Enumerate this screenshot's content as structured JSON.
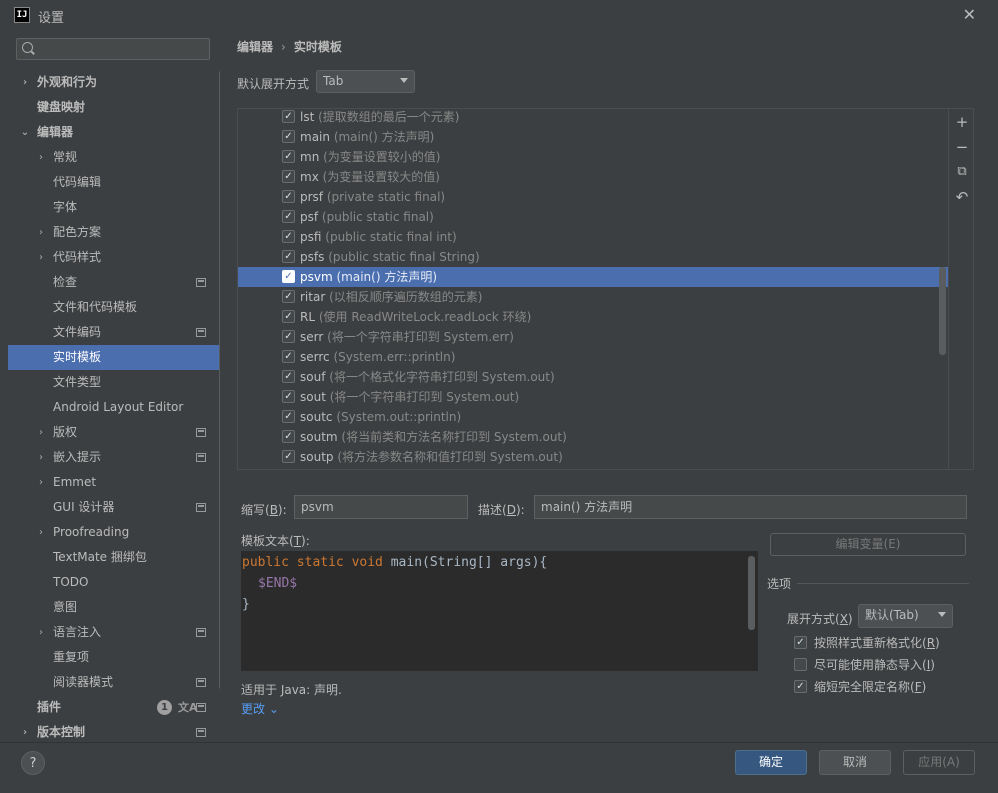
{
  "window": {
    "title": "设置",
    "app_icon": "IJ"
  },
  "sidebar": {
    "search_placeholder": "",
    "items": [
      {
        "label": "外观和行为",
        "level": 0,
        "arrow": "›",
        "bold": true
      },
      {
        "label": "键盘映射",
        "level": 0,
        "arrow": "",
        "bold": true
      },
      {
        "label": "编辑器",
        "level": 0,
        "arrow": "⌄",
        "bold": true
      },
      {
        "label": "常规",
        "level": 1,
        "arrow": "›"
      },
      {
        "label": "代码编辑",
        "level": 1,
        "arrow": ""
      },
      {
        "label": "字体",
        "level": 1,
        "arrow": ""
      },
      {
        "label": "配色方案",
        "level": 1,
        "arrow": "›"
      },
      {
        "label": "代码样式",
        "level": 1,
        "arrow": "›"
      },
      {
        "label": "检查",
        "level": 1,
        "arrow": "",
        "proj": true
      },
      {
        "label": "文件和代码模板",
        "level": 1,
        "arrow": ""
      },
      {
        "label": "文件编码",
        "level": 1,
        "arrow": "",
        "proj": true
      },
      {
        "label": "实时模板",
        "level": 1,
        "arrow": "",
        "selected": true
      },
      {
        "label": "文件类型",
        "level": 1,
        "arrow": ""
      },
      {
        "label": "Android Layout Editor",
        "level": 1,
        "arrow": ""
      },
      {
        "label": "版权",
        "level": 1,
        "arrow": "›",
        "proj": true
      },
      {
        "label": "嵌入提示",
        "level": 1,
        "arrow": "›",
        "proj": true
      },
      {
        "label": "Emmet",
        "level": 1,
        "arrow": "›"
      },
      {
        "label": "GUI 设计器",
        "level": 1,
        "arrow": "",
        "proj": true
      },
      {
        "label": "Proofreading",
        "level": 1,
        "arrow": "›"
      },
      {
        "label": "TextMate 捆绑包",
        "level": 1,
        "arrow": ""
      },
      {
        "label": "TODO",
        "level": 1,
        "arrow": ""
      },
      {
        "label": "意图",
        "level": 1,
        "arrow": ""
      },
      {
        "label": "语言注入",
        "level": 1,
        "arrow": "›",
        "proj": true
      },
      {
        "label": "重复项",
        "level": 1,
        "arrow": ""
      },
      {
        "label": "阅读器模式",
        "level": 1,
        "arrow": "",
        "proj": true
      },
      {
        "label": "插件",
        "level": 0,
        "arrow": "",
        "bold": true,
        "badge": "1",
        "proj": true,
        "translate_icon": "文A"
      },
      {
        "label": "版本控制",
        "level": 0,
        "arrow": "›",
        "bold": true,
        "proj": true
      }
    ]
  },
  "main": {
    "breadcrumb": {
      "part1": "编辑器",
      "separator": "›",
      "part2": "实时模板"
    },
    "expand_label": "默认展开方式",
    "expand_value": "Tab",
    "templates": [
      {
        "abbr": "lst",
        "desc": "(提取数组的最后一个元素)",
        "checked": true
      },
      {
        "abbr": "main",
        "desc": "(main() 方法声明)",
        "checked": true
      },
      {
        "abbr": "mn",
        "desc": "(为变量设置较小的值)",
        "checked": true
      },
      {
        "abbr": "mx",
        "desc": "(为变量设置较大的值)",
        "checked": true
      },
      {
        "abbr": "prsf",
        "desc": "(private static final)",
        "checked": true
      },
      {
        "abbr": "psf",
        "desc": "(public static final)",
        "checked": true
      },
      {
        "abbr": "psfi",
        "desc": "(public static final int)",
        "checked": true
      },
      {
        "abbr": "psfs",
        "desc": "(public static final String)",
        "checked": true
      },
      {
        "abbr": "psvm",
        "desc": "(main() 方法声明)",
        "checked": true,
        "selected": true
      },
      {
        "abbr": "ritar",
        "desc": "(以相反顺序遍历数组的元素)",
        "checked": true
      },
      {
        "abbr": "RL",
        "desc": "(使用 ReadWriteLock.readLock 环绕)",
        "checked": true
      },
      {
        "abbr": "serr",
        "desc": "(将一个字符串打印到 System.err)",
        "checked": true
      },
      {
        "abbr": "serrc",
        "desc": "(System.err::println)",
        "checked": true
      },
      {
        "abbr": "souf",
        "desc": "(将一个格式化字符串打印到 System.out)",
        "checked": true
      },
      {
        "abbr": "sout",
        "desc": "(将一个字符串打印到 System.out)",
        "checked": true
      },
      {
        "abbr": "soutc",
        "desc": "(System.out::println)",
        "checked": true
      },
      {
        "abbr": "soutm",
        "desc": "(将当前类和方法名称打印到 System.out)",
        "checked": true
      },
      {
        "abbr": "soutp",
        "desc": "(将方法参数名称和值打印到 System.out)",
        "checked": true
      }
    ],
    "tools": {
      "add": "+",
      "remove": "−",
      "copy": "⧉",
      "revert": "↶"
    },
    "abbreviation": {
      "label": "缩写(",
      "mnemonic": "B",
      "suffix": "):",
      "value": "psvm"
    },
    "description": {
      "label": "描述(",
      "mnemonic": "D",
      "suffix": "):",
      "value": "main() 方法声明"
    },
    "template_text": {
      "label": "模板文本(",
      "mnemonic": "T",
      "suffix": "):"
    },
    "code": {
      "line1_kw": "public static void",
      "line1_rest": " main(String[] args){",
      "line2": "$END$",
      "line3": "}"
    },
    "edit_vars_button": "编辑变量(E)",
    "applicable": "适用于 Java: 声明.",
    "change_link": "更改 ⌄",
    "options": {
      "title": "选项",
      "expand_with_label": "展开方式(",
      "expand_with_mnemonic": "X",
      "expand_with_suffix": ")",
      "expand_with_value": "默认(Tab)",
      "reformat": {
        "label": "按照样式重新格式化(",
        "mnemonic": "R",
        "suffix": ")",
        "checked": true
      },
      "static_import": {
        "label": "尽可能使用静态导入(",
        "mnemonic": "I",
        "suffix": ")",
        "checked": false
      },
      "shorten_fq": {
        "label": "缩短完全限定名称(",
        "mnemonic": "F",
        "suffix": ")",
        "checked": true
      }
    }
  },
  "footer": {
    "help": "?",
    "ok": "确定",
    "cancel": "取消",
    "apply": "应用(A)"
  }
}
